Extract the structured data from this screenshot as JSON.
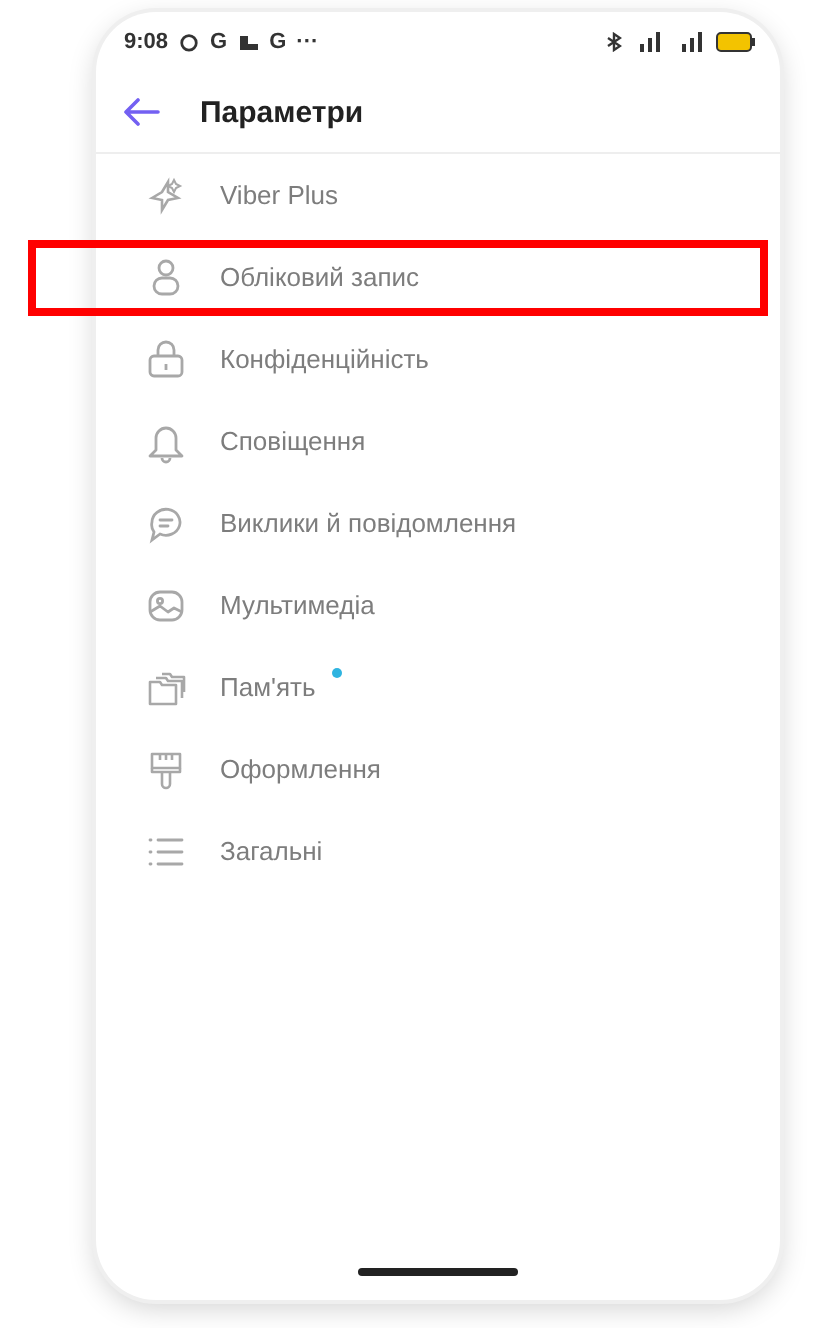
{
  "status_bar": {
    "time": "9:08",
    "indicators": [
      "G",
      "G",
      "···"
    ]
  },
  "header": {
    "title": "Параметри"
  },
  "items": [
    {
      "label": "Viber Plus",
      "kind": "sparkle",
      "highlighted": false
    },
    {
      "label": "Обліковий запис",
      "kind": "person",
      "highlighted": true
    },
    {
      "label": "Конфіденційність",
      "kind": "lock",
      "highlighted": false
    },
    {
      "label": "Сповіщення",
      "kind": "bell",
      "highlighted": false
    },
    {
      "label": "Виклики й повідомлення",
      "kind": "chat",
      "highlighted": false
    },
    {
      "label": "Мультимедіа",
      "kind": "media",
      "highlighted": false
    },
    {
      "label": "Пам'ять",
      "kind": "folders",
      "highlighted": false,
      "color": "#2fb4e0"
    },
    {
      "label": "Оформлення",
      "kind": "brush",
      "highlighted": false
    },
    {
      "label": "Загальні",
      "kind": "list",
      "highlighted": false
    }
  ]
}
